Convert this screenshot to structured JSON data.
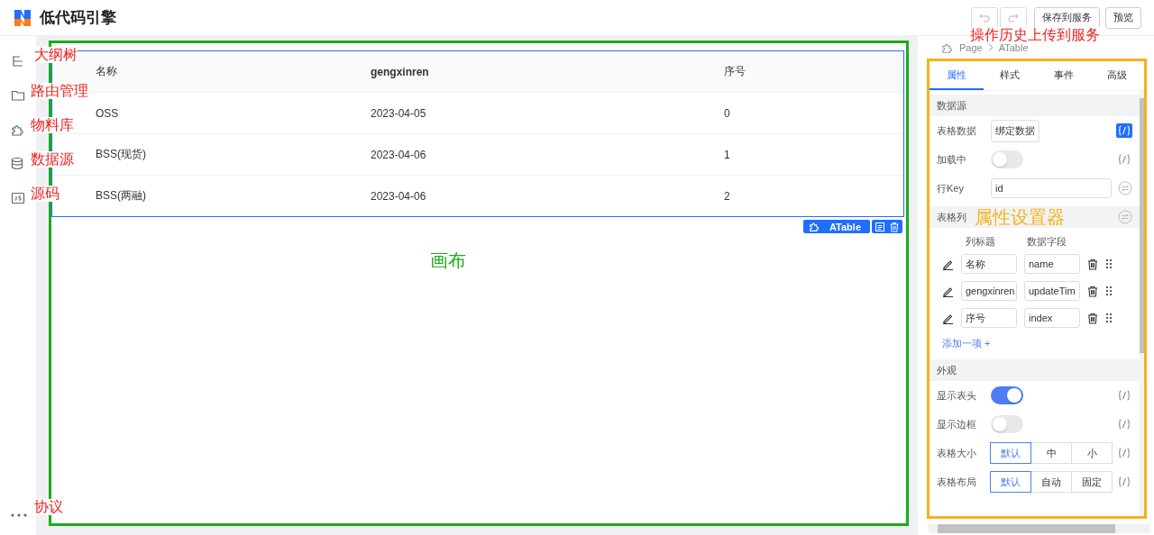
{
  "header": {
    "title": "低代码引擎",
    "history_buttons": [
      {
        "kind": "undo",
        "disabled": true
      },
      {
        "kind": "redo",
        "disabled": true
      }
    ],
    "buttons": [
      "保存到服务",
      "预览"
    ],
    "annotation": "操作历史上传到服务"
  },
  "sidebar": {
    "items": [
      {
        "kind": "outline",
        "annotation": "大纲树"
      },
      {
        "kind": "folder",
        "annotation": "路由管理"
      },
      {
        "kind": "puzzle",
        "annotation": "物料库"
      },
      {
        "kind": "database",
        "annotation": "数据源"
      },
      {
        "kind": "js",
        "annotation": "源码"
      }
    ],
    "bottom_items": [
      {
        "kind": "more",
        "annotation": "协议"
      }
    ]
  },
  "canvas": {
    "annotation": "画布",
    "table": {
      "selected": true,
      "columns": [
        "名称",
        "gengxinren",
        "序号"
      ],
      "rows": [
        [
          "OSS",
          "2023-04-05",
          "0"
        ],
        [
          "BSS(现货)",
          "2023-04-06",
          "1"
        ],
        [
          "BSS(两融)",
          "2023-04-06",
          "2"
        ]
      ]
    },
    "selection_toolbar": {
      "component": "ATable"
    }
  },
  "settings": {
    "annotation": "属性设置器",
    "breadcrumb": [
      "Page",
      "ATable"
    ],
    "tabs": [
      {
        "label": "属性",
        "selected": true
      },
      {
        "label": "样式",
        "selected": false
      },
      {
        "label": "事件",
        "selected": false
      },
      {
        "label": "高级",
        "selected": false
      }
    ],
    "sections": [
      {
        "kind": "group",
        "title": "数据源",
        "items": [
          {
            "kind": "bind-button",
            "label": "表格数据",
            "value": "绑定数据",
            "variable_bound": true
          },
          {
            "kind": "switch",
            "label": "加载中",
            "on": false,
            "variable_bound": false
          },
          {
            "kind": "input",
            "label": "行Key",
            "value": "id"
          }
        ]
      },
      {
        "kind": "list",
        "title": "表格列",
        "items": [
          {
            "kind": "column-list",
            "headers": [
              "列标题",
              "数据字段"
            ],
            "columns": [
              {
                "title": "名称",
                "field": "name"
              },
              {
                "title": "gengxinren",
                "field": "updateTim"
              },
              {
                "title": "序号",
                "field": "index"
              }
            ],
            "add_label": "添加一项 +"
          }
        ]
      },
      {
        "kind": "group",
        "title": "外观",
        "items": [
          {
            "kind": "switch",
            "label": "显示表头",
            "on": true,
            "variable_bound": false
          },
          {
            "kind": "switch",
            "label": "显示边框",
            "on": false,
            "variable_bound": false
          },
          {
            "kind": "segmented",
            "label": "表格大小",
            "options": [
              {
                "label": "默认",
                "selected": true
              },
              {
                "label": "中",
                "selected": false
              },
              {
                "label": "小",
                "selected": false
              }
            ],
            "variable_bound": false
          },
          {
            "kind": "segmented",
            "label": "表格布局",
            "options": [
              {
                "label": "默认",
                "selected": true
              },
              {
                "label": "自动",
                "selected": false
              },
              {
                "label": "固定",
                "selected": false
              }
            ],
            "variable_bound": false
          }
        ]
      }
    ]
  }
}
